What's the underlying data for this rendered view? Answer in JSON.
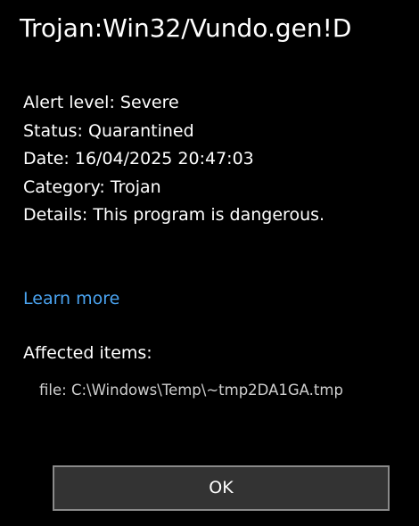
{
  "threat": {
    "name": "Trojan:Win32/Vundo.gen!D"
  },
  "details": [
    {
      "label": "Alert level:",
      "value": "Severe"
    },
    {
      "label": "Status:",
      "value": "Quarantined"
    },
    {
      "label": "Date:",
      "value": "16/04/2025 20:47:03"
    },
    {
      "label": "Category:",
      "value": "Trojan"
    },
    {
      "label": "Details:",
      "value": "This program is dangerous."
    }
  ],
  "learn_more": "Learn more",
  "affected": {
    "heading": "Affected items:",
    "items": [
      {
        "label": "file:",
        "value": "C:\\Windows\\Temp\\~tmp2DA1GA.tmp"
      }
    ]
  },
  "ok_button": "OK",
  "colors": {
    "background": "#000000",
    "text": "#ffffff",
    "link": "#4aa3f0",
    "button_bg": "#333333",
    "button_border": "#8a8a8a"
  }
}
